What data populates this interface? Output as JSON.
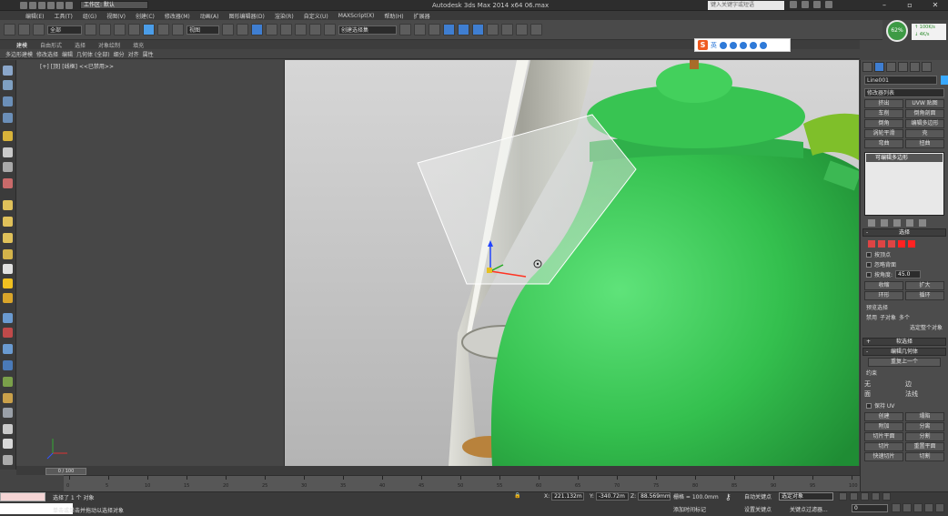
{
  "title_bar": {
    "workspace": "工作区: 默认",
    "window_title": "Autodesk 3ds Max  2014 x64      06.max",
    "search_placeholder": "键入关键字或短语",
    "window_buttons": [
      "–",
      "▫",
      "✕"
    ]
  },
  "menu": [
    "编辑(E)",
    "工具(T)",
    "组(G)",
    "视图(V)",
    "创建(C)",
    "修改器(M)",
    "动画(A)",
    "图形编辑器(D)",
    "渲染(R)",
    "自定义(U)",
    "MAXScript(X)",
    "帮助(H)",
    "扩展器"
  ],
  "toolbar": {
    "selection_filter": "全部",
    "ref_coord": "视图",
    "named_selection": "创建选择集"
  },
  "cpu_meter": {
    "value": "62%"
  },
  "net_meter": {
    "up": "↑ 100K/s",
    "down": "↓ 4K/s"
  },
  "ribbon": {
    "tabs": [
      "建模",
      "自由形式",
      "选择",
      "对象绘制",
      "填充"
    ],
    "active_tab": "建模",
    "row2": [
      "多边形建模",
      "修改选择",
      "编辑",
      "几何体 (全部)",
      "细分",
      "对齐",
      "属性"
    ]
  },
  "ime": {
    "logo": "S",
    "lang": "英"
  },
  "viewport_left": {
    "label_prefix": "[+]",
    "label_view": "[顶]",
    "label_shading": "[线框]",
    "label_extra": "<<已禁用>>"
  },
  "command_panel": {
    "object_name": "Line001",
    "modifier_list": "修改器列表",
    "buttons": [
      "挤出",
      "UVW 贴图",
      "车削",
      "倒角剖面",
      "倒角",
      "编辑多边形",
      "涡轮平滑",
      "壳",
      "弯曲",
      "扭曲"
    ],
    "stack_item": "可编辑多边形",
    "rollout_selection": "选择",
    "check_by_vertex": "按顶点",
    "check_ignore_backfacing": "忽略背面",
    "check_angle": "按角度:",
    "angle_value": "45.0",
    "shrink": "收缩",
    "grow": "扩大",
    "ring": "环形",
    "loop": "循环",
    "preview_selection": "预览选择",
    "preview_off": "禁用",
    "preview_subobj": "子对象",
    "preview_multi": "多个",
    "selected_count": "选定整个对象",
    "rollout_soft": "软选择",
    "rollout_edit_geo": "编辑几何体",
    "repeat_last": "重复上一个",
    "constraints_label": "约束",
    "constraints_opts": [
      "无",
      "边",
      "面",
      "法线"
    ],
    "preserve_uv": "保持 UV",
    "create": "创建",
    "collapse": "塌陷",
    "attach": "附加",
    "detach": "分离",
    "slice_plane": "切片平面",
    "split": "分割",
    "slice": "切片",
    "reset_plane": "重置平面",
    "quickslice": "快速切片",
    "cut": "切割"
  },
  "timeline": {
    "slider": "0 / 100",
    "ticks": [
      "0",
      "5",
      "10",
      "15",
      "20",
      "25",
      "30",
      "35",
      "40",
      "45",
      "50",
      "55",
      "60",
      "65",
      "70",
      "75",
      "80",
      "85",
      "90",
      "95",
      "100"
    ]
  },
  "status": {
    "selected": "选择了 1 个 对象",
    "prompt": "单击或单击并拖动以选择对象",
    "x_label": "X:",
    "x_value": "221.132m",
    "y_label": "Y:",
    "y_value": "-340.72m",
    "z_label": "Z:",
    "z_value": "88.569mm",
    "grid": "栅格 = 100.0mm",
    "add_time_tag": "添加时间标记",
    "auto_key": "自动关键点",
    "set_key": "设置关键点",
    "key_filter": "选定对象",
    "key_filters_btn": "关键点过滤器...",
    "frame": "0"
  }
}
